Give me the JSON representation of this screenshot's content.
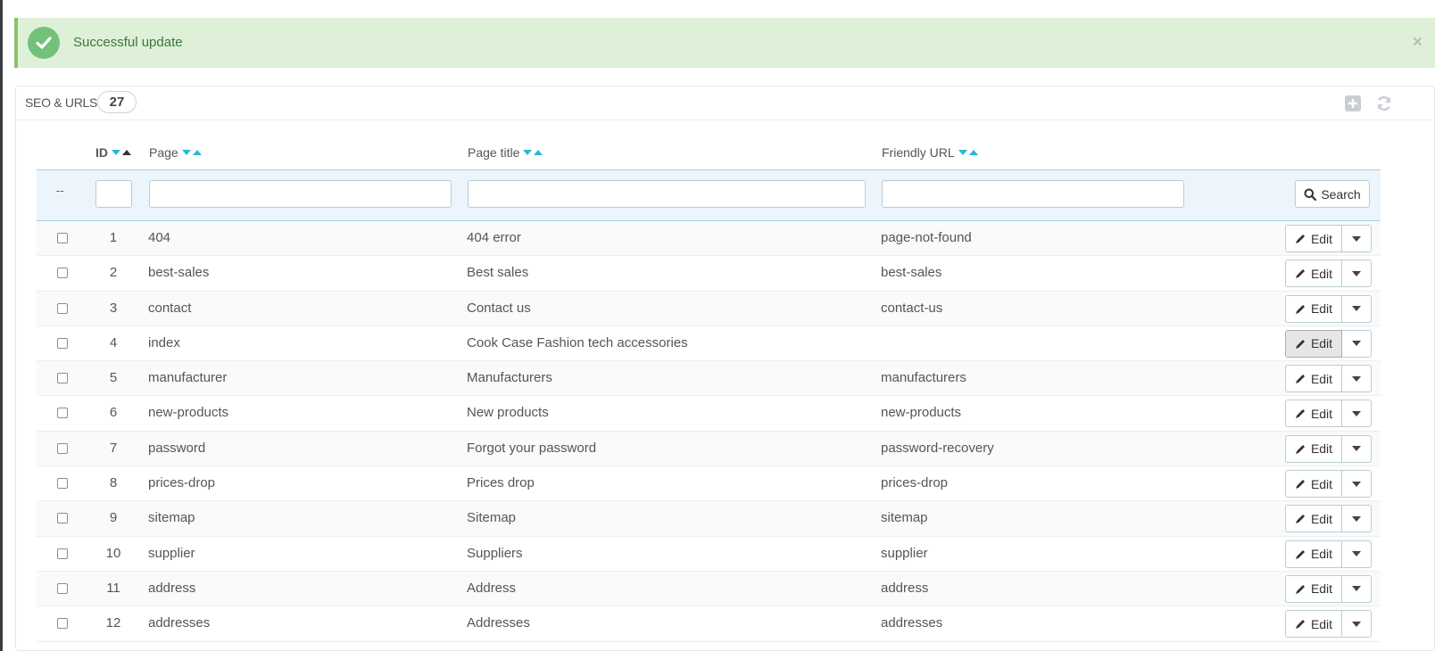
{
  "alert": {
    "message": "Successful update",
    "close_label": "×",
    "icon": "check-circle-icon"
  },
  "panel": {
    "title": "SEO & URLS",
    "count": "27",
    "add_icon": "add-icon",
    "refresh_icon": "refresh-icon"
  },
  "table": {
    "columns": {
      "id": "ID",
      "page": "Page",
      "page_title": "Page title",
      "friendly_url": "Friendly URL"
    },
    "filter": {
      "bulk_placeholder": "--",
      "search_label": "Search"
    },
    "action_label": "Edit",
    "rows": [
      {
        "id": "1",
        "page": "404",
        "title": "404 error",
        "url": "page-not-found"
      },
      {
        "id": "2",
        "page": "best-sales",
        "title": "Best sales",
        "url": "best-sales"
      },
      {
        "id": "3",
        "page": "contact",
        "title": "Contact us",
        "url": "contact-us"
      },
      {
        "id": "4",
        "page": "index",
        "title": "Cook Case Fashion tech accessories",
        "url": ""
      },
      {
        "id": "5",
        "page": "manufacturer",
        "title": "Manufacturers",
        "url": "manufacturers"
      },
      {
        "id": "6",
        "page": "new-products",
        "title": "New products",
        "url": "new-products"
      },
      {
        "id": "7",
        "page": "password",
        "title": "Forgot your password",
        "url": "password-recovery"
      },
      {
        "id": "8",
        "page": "prices-drop",
        "title": "Prices drop",
        "url": "prices-drop"
      },
      {
        "id": "9",
        "page": "sitemap",
        "title": "Sitemap",
        "url": "sitemap"
      },
      {
        "id": "10",
        "page": "supplier",
        "title": "Suppliers",
        "url": "supplier"
      },
      {
        "id": "11",
        "page": "address",
        "title": "Address",
        "url": "address"
      },
      {
        "id": "12",
        "page": "addresses",
        "title": "Addresses",
        "url": "addresses"
      }
    ]
  },
  "colors": {
    "accent": "#25b9d7",
    "success_bg": "#dff0d8",
    "success_text": "#3c763d"
  }
}
